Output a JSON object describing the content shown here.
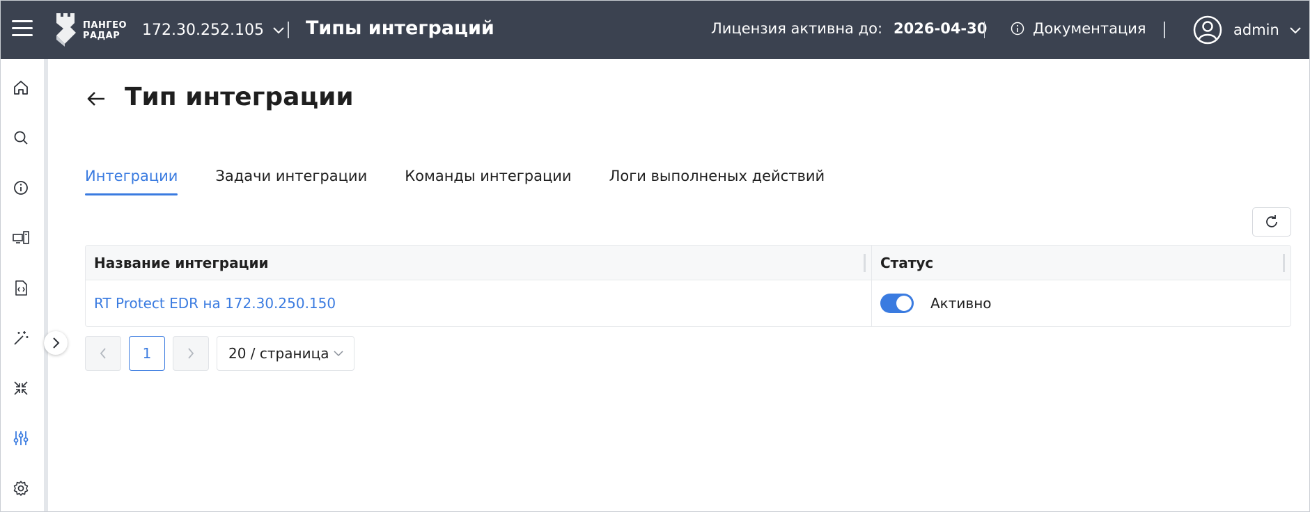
{
  "header": {
    "logo_line1": "ПАНГЕО",
    "logo_line2": "РАДАР",
    "host": "172.30.252.105",
    "section_title": "Типы интеграций",
    "license_label": "Лицензия активна до:",
    "license_date": "2026-04-30",
    "docs_label": "Документация",
    "username": "admin"
  },
  "sidebar": {
    "items": [
      {
        "name": "home",
        "icon": "home-icon"
      },
      {
        "name": "search",
        "icon": "search-icon"
      },
      {
        "name": "info",
        "icon": "info-icon"
      },
      {
        "name": "assets",
        "icon": "devices-icon"
      },
      {
        "name": "documents",
        "icon": "code-file-icon"
      },
      {
        "name": "magic",
        "icon": "magic-wand-icon"
      },
      {
        "name": "compress",
        "icon": "collapse-arrows-icon"
      },
      {
        "name": "settings-sliders",
        "icon": "sliders-icon",
        "active": true
      },
      {
        "name": "settings",
        "icon": "gear-icon"
      }
    ],
    "active_color": "#3a7be0"
  },
  "page": {
    "title": "Тип интеграции",
    "tabs": [
      {
        "label": "Интеграции",
        "active": true
      },
      {
        "label": "Задачи интеграции"
      },
      {
        "label": "Команды интеграции"
      },
      {
        "label": "Логи выполненых действий"
      }
    ]
  },
  "table": {
    "columns": [
      "Название интеграции",
      "Статус"
    ],
    "rows": [
      {
        "name": "RT Protect EDR на 172.30.250.150",
        "enabled": true,
        "status": "Активно"
      }
    ]
  },
  "pagination": {
    "current_page": "1",
    "page_size": "20 / страница"
  },
  "colors": {
    "topbar": "#3b4250",
    "accent": "#3a7be0"
  }
}
